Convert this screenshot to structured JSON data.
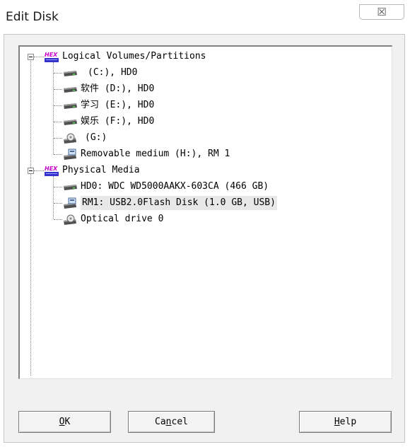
{
  "window": {
    "title": "Edit Disk",
    "close_glyph": "☒"
  },
  "tree": {
    "groups": [
      {
        "label": "Logical Volumes/Partitions",
        "icon": "hex-icon",
        "items": [
          {
            "label": "(C:), HD0",
            "icon": "hard-drive-icon"
          },
          {
            "label": "软件 (D:), HD0",
            "icon": "hard-drive-icon"
          },
          {
            "label": "学习 (E:), HD0",
            "icon": "hard-drive-icon"
          },
          {
            "label": "娱乐 (F:), HD0",
            "icon": "hard-drive-icon"
          },
          {
            "label": "(G:)",
            "icon": "optical-drive-icon"
          },
          {
            "label": "Removable medium (H:), RM 1",
            "icon": "removable-drive-icon"
          }
        ]
      },
      {
        "label": "Physical Media",
        "icon": "hex-icon",
        "items": [
          {
            "label": "HD0: WDC WD5000AAKX-603CA (466 GB)",
            "icon": "hard-drive-icon"
          },
          {
            "label": "RM1: USB2.0Flash Disk (1.0 GB, USB)",
            "icon": "removable-drive-icon",
            "selected": true
          },
          {
            "label": "Optical drive 0",
            "icon": "optical-drive-icon"
          }
        ]
      }
    ]
  },
  "buttons": {
    "ok": {
      "pre": "",
      "u": "O",
      "post": "K"
    },
    "cancel": {
      "pre": "Ca",
      "u": "n",
      "post": "cel"
    },
    "help": {
      "pre": "",
      "u": "H",
      "post": "elp"
    }
  },
  "colors": {
    "dialog_bg": "#f1f1f1",
    "tree_bg": "#ffffff",
    "selection": "#e8e8e8",
    "hex_icon_text": "#cc00cc",
    "hex_icon_bar": "#3333cc"
  }
}
